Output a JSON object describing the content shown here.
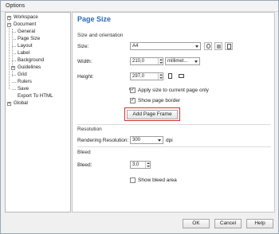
{
  "window": {
    "title": "Options"
  },
  "tree": [
    {
      "label": "Workspace",
      "expander": "+"
    },
    {
      "label": "Document",
      "expander": "−"
    },
    {
      "label": "General"
    },
    {
      "label": "Page Size"
    },
    {
      "label": "Layout"
    },
    {
      "label": "Label"
    },
    {
      "label": "Background"
    },
    {
      "label": "Guidelines",
      "expander": "+"
    },
    {
      "label": "Grid"
    },
    {
      "label": "Rulers"
    },
    {
      "label": "Save"
    },
    {
      "label": "Export To HTML"
    },
    {
      "label": "Global",
      "expander": "+"
    }
  ],
  "panel": {
    "title": "Page Size",
    "size_orientation": {
      "section": "Size and orientation",
      "size_label": "Size:",
      "size_value": "A4",
      "width_label": "Width:",
      "width_value": "210,0",
      "units_value": "millimet...",
      "height_label": "Height:",
      "height_value": "297,0",
      "apply_current": "Apply size to current page only",
      "show_border": "Show page border",
      "add_frame": "Add Page Frame"
    },
    "resolution": {
      "section": "Resolution",
      "label": "Rendering Resolution:",
      "value": "300",
      "unit": "dpi"
    },
    "bleed": {
      "section": "Bleed",
      "label": "Bleed:",
      "value": "3,0",
      "show_area": "Show bleed area"
    }
  },
  "footer": {
    "ok": "OK",
    "cancel": "Cancel",
    "help": "Help"
  },
  "colors": {
    "accent": "#2a6ab6",
    "highlight": "#d93131"
  }
}
